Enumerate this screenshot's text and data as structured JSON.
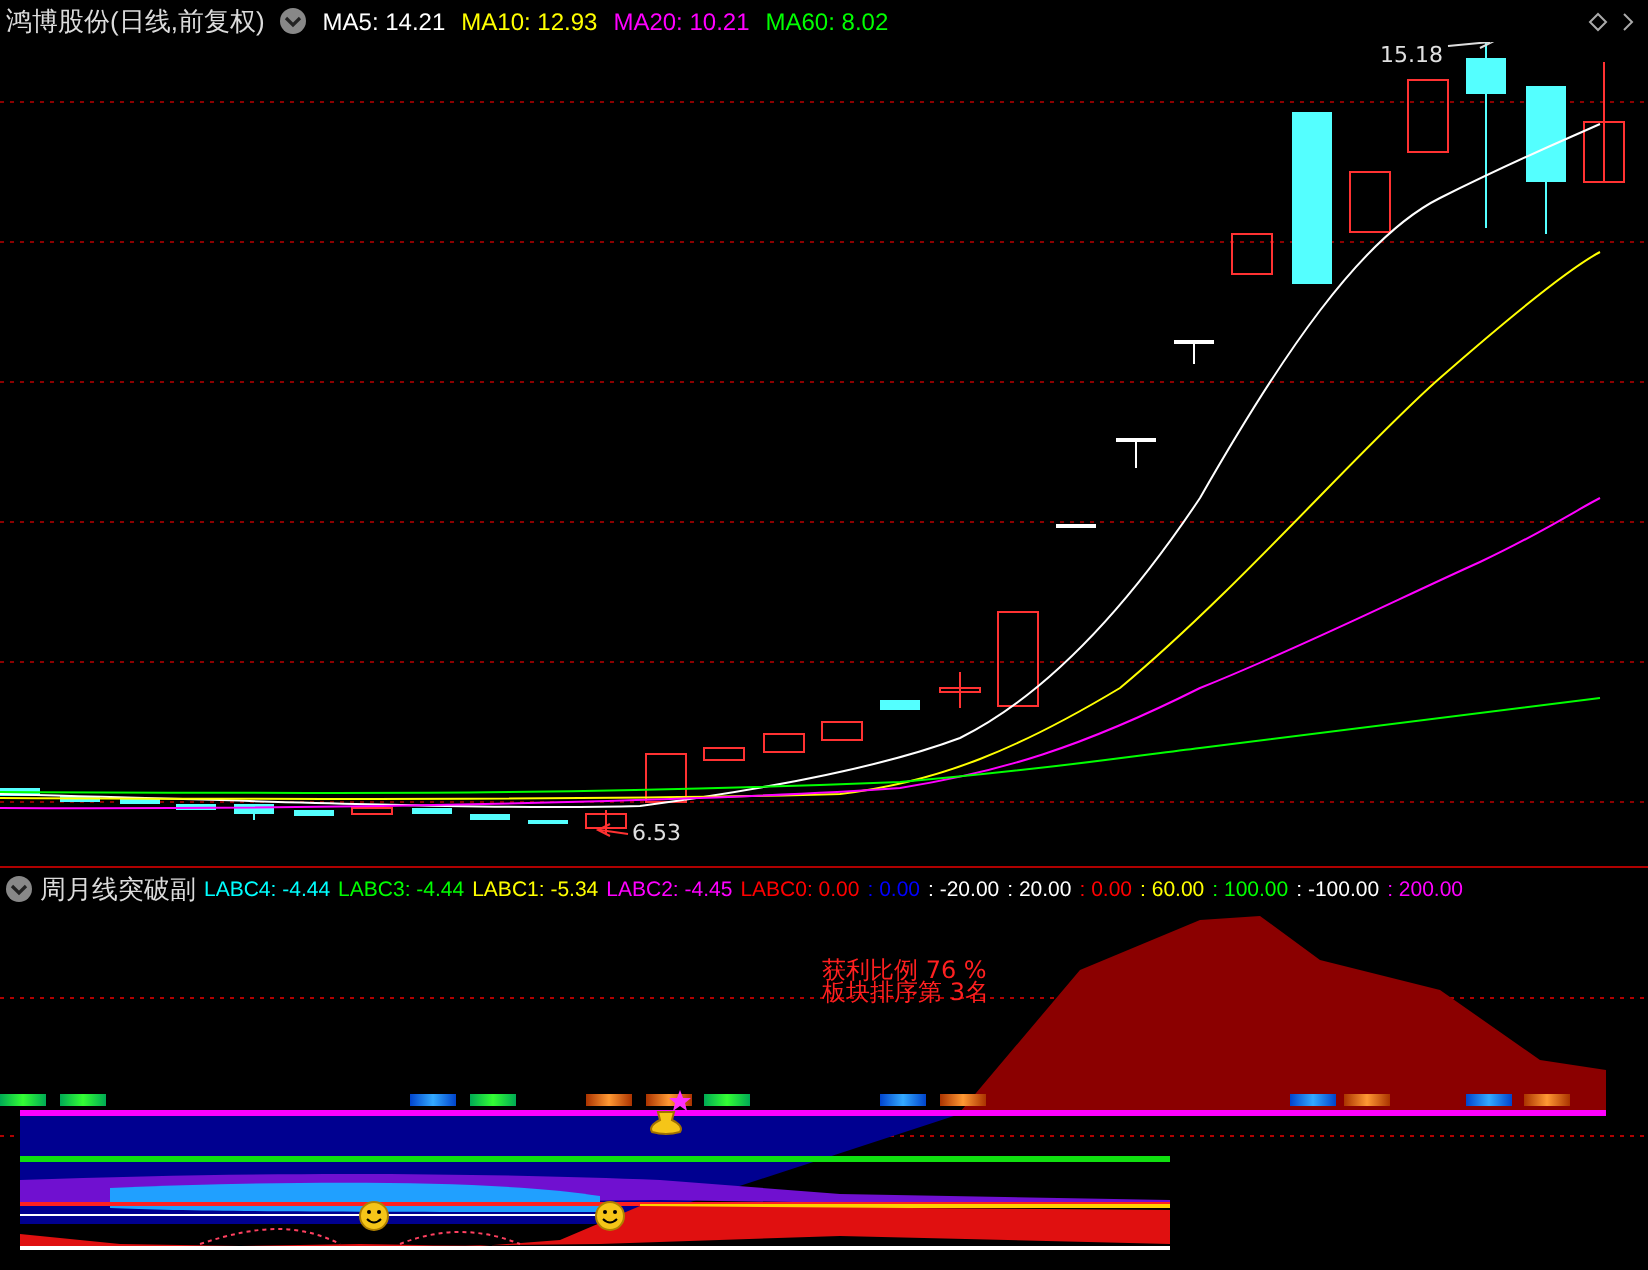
{
  "main_chart": {
    "title": "鸿博股份(日线,前复权)",
    "legend": [
      {
        "text": "MA5: 14.21",
        "color": "#ffffff"
      },
      {
        "text": "MA10: 12.93",
        "color": "#ffff00"
      },
      {
        "text": "MA20: 10.21",
        "color": "#ff00ff"
      },
      {
        "text": "MA60: 8.02",
        "color": "#00ff00"
      }
    ],
    "high_label": "15.18",
    "low_label": "6.53"
  },
  "indicator": {
    "title": "周月线突破副",
    "legend": [
      {
        "text": "LABC4: -4.44",
        "color": "#00ffff"
      },
      {
        "text": "LABC3: -4.44",
        "color": "#00ff00"
      },
      {
        "text": "LABC1: -5.34",
        "color": "#ffff00"
      },
      {
        "text": "LABC2: -4.45",
        "color": "#ff00ff"
      },
      {
        "text": "LABC0: 0.00",
        "color": "#ff0000"
      },
      {
        "text": ": 0.00",
        "color": "#0000ff"
      },
      {
        "text": ": -20.00",
        "color": "#ffffff"
      },
      {
        "text": ": 20.00",
        "color": "#ffffff"
      },
      {
        "text": ": 0.00",
        "color": "#ff0000"
      },
      {
        "text": ": 60.00",
        "color": "#ffff00"
      },
      {
        "text": ": 100.00",
        "color": "#00ff00"
      },
      {
        "text": ": -100.00",
        "color": "#ffffff"
      },
      {
        "text": ": 200.00",
        "color": "#ff00ff"
      }
    ],
    "notes": [
      "获利比例 76 %",
      "板块排序第 3名"
    ]
  }
}
